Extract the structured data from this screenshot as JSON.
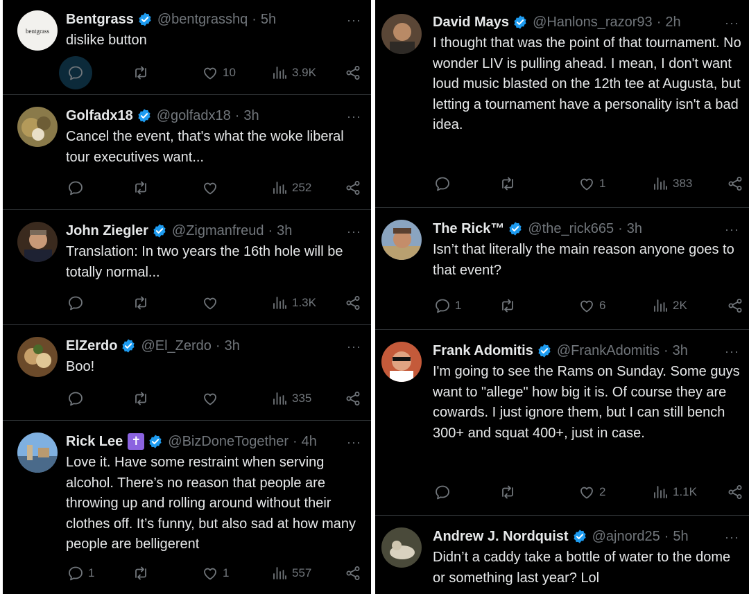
{
  "colors": {
    "background": "#000000",
    "text": "#e7e9ea",
    "muted": "#71767b",
    "verified": "#1d9bf0",
    "divider": "#2f3336"
  },
  "icons": [
    "reply-icon",
    "retweet-icon",
    "like-icon",
    "views-icon",
    "share-icon",
    "verified-badge-icon",
    "more-icon"
  ],
  "left": {
    "tweets": [
      {
        "name": "Bentgrass",
        "handle": "@bentgrasshq",
        "time": "5h",
        "avatar_label": "bentgrass",
        "text": "dislike button",
        "replies": "",
        "retweets": "",
        "likes": "10",
        "views": "3.9K"
      },
      {
        "name": "Golfadx18",
        "handle": "@golfadx18",
        "time": "3h",
        "text": "Cancel the event, that's what the woke liberal tour executives want...",
        "replies": "",
        "retweets": "",
        "likes": "",
        "views": "252"
      },
      {
        "name": "John Ziegler",
        "handle": "@Zigmanfreud",
        "time": "3h",
        "text": "Translation: In two years the 16th hole will be totally normal...",
        "replies": "",
        "retweets": "",
        "likes": "",
        "views": "1.3K"
      },
      {
        "name": "ElZerdo",
        "handle": "@El_Zerdo",
        "time": "3h",
        "text": "Boo!",
        "replies": "",
        "retweets": "",
        "likes": "",
        "views": "335"
      },
      {
        "name": "Rick Lee",
        "name_emoji": "✝",
        "handle": "@BizDoneTogether",
        "time": "4h",
        "text": "Love it. Have some restraint when serving alcohol. There’s no reason that people are throwing up and rolling around without their clothes off. It’s funny, but also sad at how many people are belligerent",
        "replies": "1",
        "retweets": "",
        "likes": "1",
        "views": "557"
      }
    ]
  },
  "right": {
    "tweets": [
      {
        "name": "David Mays",
        "handle": "@Hanlons_razor93",
        "time": "2h",
        "text": "I thought that was the point of that tournament.  No wonder LIV is pulling ahead.  I mean, I don't want loud music blasted on the 12th tee at Augusta, but letting a tournament have a personality isn't a bad idea.",
        "replies": "",
        "retweets": "",
        "likes": "1",
        "views": "383"
      },
      {
        "name": "The Rick™",
        "handle": "@the_rick665",
        "time": "3h",
        "text": "Isn’t that literally the main reason anyone goes to that event?",
        "replies": "1",
        "retweets": "",
        "likes": "6",
        "views": "2K"
      },
      {
        "name": "Frank Adomitis",
        "handle": "@FrankAdomitis",
        "time": "3h",
        "text": "I'm going to see the Rams on Sunday.  Some guys want to \"allege\" how big it is.  Of course they are cowards. I just ignore them, but I can still bench 300+ and squat 400+, just in case.",
        "replies": "",
        "retweets": "",
        "likes": "2",
        "views": "1.1K"
      },
      {
        "name": "Andrew J. Nordquist",
        "handle": "@ajnord25",
        "time": "5h",
        "text": "Didn’t a caddy take a bottle of water to the dome or something last year? Lol",
        "replies": "",
        "retweets": "",
        "likes": "",
        "views": ""
      }
    ]
  },
  "ui": {
    "more": "···",
    "sep": "·"
  }
}
